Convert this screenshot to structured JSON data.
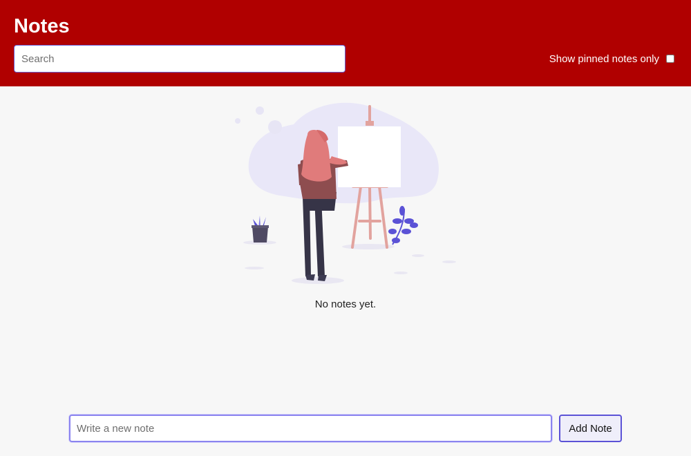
{
  "header": {
    "title": "Notes",
    "search_placeholder": "Search",
    "search_value": "",
    "pinned_only_label": "Show pinned notes only",
    "pinned_only_checked": false
  },
  "empty_state": {
    "illustration_icon": "woman-painting-easel-illustration",
    "message": "No notes yet."
  },
  "composer": {
    "note_placeholder": "Write a new note",
    "note_value": "",
    "add_button_label": "Add Note"
  },
  "colors": {
    "header_background": "#b00000",
    "page_background": "#f7f7f7",
    "accent": "#5b52d6"
  }
}
